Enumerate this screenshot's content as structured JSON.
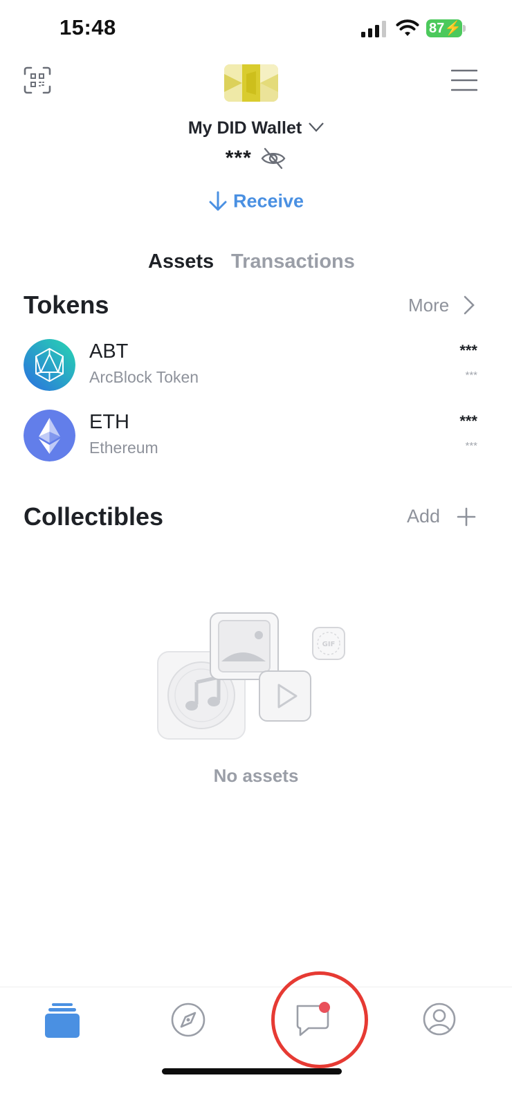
{
  "status_bar": {
    "time": "15:48",
    "battery": "87"
  },
  "header": {
    "wallet_name": "My DID Wallet",
    "balance": "***",
    "receive_label": "Receive"
  },
  "tabs": [
    {
      "label": "Assets",
      "active": true
    },
    {
      "label": "Transactions",
      "active": false
    }
  ],
  "tokens": {
    "title": "Tokens",
    "more_label": "More",
    "items": [
      {
        "symbol": "ABT",
        "name": "ArcBlock Token",
        "amount": "***",
        "value": "***",
        "icon": "abt-logo-icon"
      },
      {
        "symbol": "ETH",
        "name": "Ethereum",
        "amount": "***",
        "value": "***",
        "icon": "ethereum-logo-icon"
      }
    ]
  },
  "collectibles": {
    "title": "Collectibles",
    "add_label": "Add",
    "empty_label": "No assets"
  },
  "illustration": {
    "gif_badge": "GIF"
  },
  "bottom_nav": [
    {
      "name": "assets",
      "icon": "wallet-stack-icon",
      "active": true
    },
    {
      "name": "explore",
      "icon": "compass-icon",
      "active": false
    },
    {
      "name": "messages",
      "icon": "chat-bubble-icon",
      "active": false,
      "notification": true
    },
    {
      "name": "profile",
      "icon": "user-circle-icon",
      "active": false
    }
  ],
  "colors": {
    "accent": "#4A90E2",
    "highlight_ring": "#E63A33",
    "notification_dot": "#E9505A",
    "battery": "#4CC95C"
  }
}
